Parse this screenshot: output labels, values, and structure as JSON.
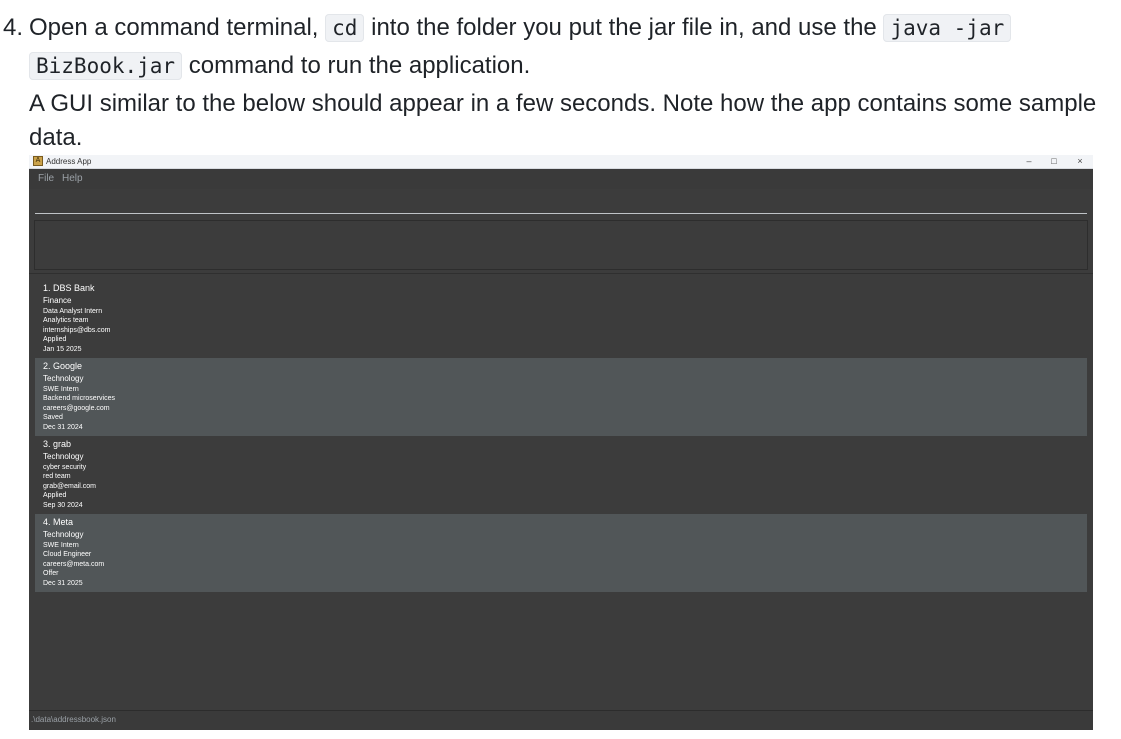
{
  "doc": {
    "step_number": "4.",
    "line1_a": "Open a command terminal,",
    "code_cd": "cd",
    "line1_b": "into the folder you put the jar file in, and use the",
    "code_java": "java -jar",
    "code_jar": "BizBook.jar",
    "line2_b": "command to run the application.",
    "line3": "A GUI similar to the below should appear in a few seconds. Note how the app contains some sample",
    "line4": "data."
  },
  "window": {
    "title": "Address App",
    "icon": "app-icon",
    "controls": {
      "minimize": "–",
      "maximize": "□",
      "close": "×"
    }
  },
  "menu": {
    "file": "File",
    "help": "Help"
  },
  "command_box": {
    "value": ""
  },
  "result_display": {
    "text": ""
  },
  "applications": [
    {
      "title": "1. DBS Bank",
      "industry": "Finance",
      "role": "Data Analyst Intern",
      "team": "Analytics team",
      "email": "internships@dbs.com",
      "status": "Applied",
      "date": "Jan 15 2025"
    },
    {
      "title": "2. Google",
      "industry": "Technology",
      "role": "SWE Intern",
      "team": "Backend microservices",
      "email": "careers@google.com",
      "status": "Saved",
      "date": "Dec 31 2024"
    },
    {
      "title": "3. grab",
      "industry": "Technology",
      "role": "cyber security",
      "team": "red team",
      "email": "grab@email.com",
      "status": "Applied",
      "date": "Sep 30 2024"
    },
    {
      "title": "4. Meta",
      "industry": "Technology",
      "role": "SWE Intern",
      "team": "Cloud Engineer",
      "email": "careers@meta.com",
      "status": "Offer",
      "date": "Dec 31 2025"
    }
  ],
  "status_bar": {
    "path": ".\\data\\addressbook.json"
  },
  "colors": {
    "window_bg": "#3c3c3c",
    "card_alt": "#515658",
    "text": "#ffffff"
  }
}
